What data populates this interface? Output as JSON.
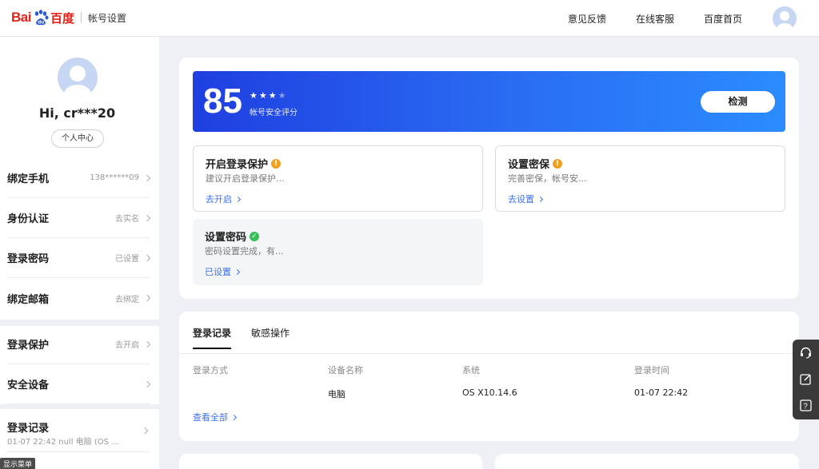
{
  "header": {
    "logo_left": "Bai",
    "logo_right": "百度",
    "logo_sub": "帐号设置",
    "nav": [
      "意见反馈",
      "在线客服",
      "百度首页"
    ]
  },
  "sidebar": {
    "greeting": "Hi, cr***20",
    "center_button": "个人中心",
    "rows": [
      {
        "label": "绑定手机",
        "value": "138******09"
      },
      {
        "label": "身份认证",
        "value": "去实名"
      },
      {
        "label": "登录密码",
        "value": "已设置"
      },
      {
        "label": "绑定邮箱",
        "value": "去绑定"
      },
      {
        "label": "登录保护",
        "value": "去开启"
      },
      {
        "label": "安全设备",
        "value": ""
      }
    ],
    "login_record": {
      "label": "登录记录",
      "sub": "01-07 22:42 null 电脑 (OS ..."
    },
    "show_menu": "显示菜单"
  },
  "security": {
    "score": "85",
    "stars_filled": 3,
    "stars_total": 4,
    "score_caption": "帐号安全评分",
    "check_button": "检测",
    "items": [
      {
        "title": "开启登录保护",
        "desc": "建议开启登录保护...",
        "link": "去开启",
        "status": "warn"
      },
      {
        "title": "设置密保",
        "desc": "完善密保，帐号安...",
        "link": "去设置",
        "status": "warn"
      },
      {
        "title": "设置密码",
        "desc": "密码设置完成，有...",
        "link": "已设置",
        "status": "ok"
      }
    ]
  },
  "records": {
    "tabs": [
      "登录记录",
      "敏感操作"
    ],
    "columns": [
      "登录方式",
      "设备名称",
      "系统",
      "登录时间"
    ],
    "row": [
      "",
      "电脑",
      "OS X10.14.6",
      "01-07 22:42"
    ],
    "view_all": "查看全部"
  },
  "colors": {
    "brand_red": "#e2231a",
    "link_blue": "#3f71e8",
    "banner_start": "#1f3fe0",
    "banner_end": "#2b8cff",
    "warn": "#f0a020",
    "ok": "#35c05a"
  }
}
